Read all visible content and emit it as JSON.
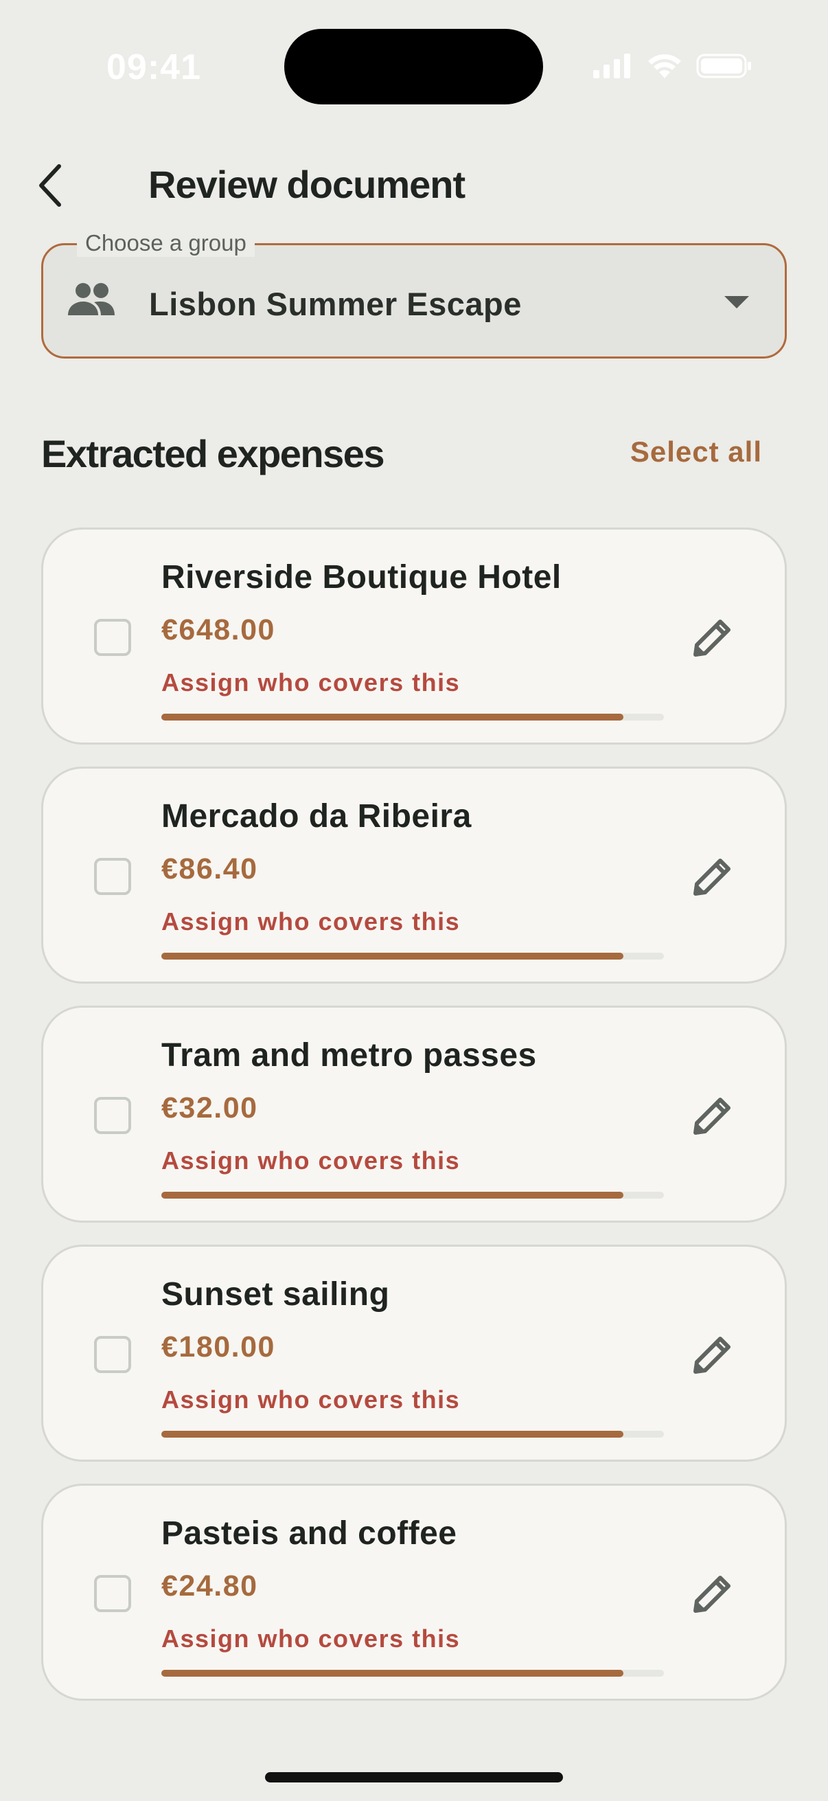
{
  "status_bar": {
    "time": "09:41"
  },
  "header": {
    "title": "Review document"
  },
  "group_select": {
    "label": "Choose a group",
    "value": "Lisbon Summer Escape"
  },
  "expenses_section": {
    "title": "Extracted expenses",
    "select_all": "Select all"
  },
  "expenses": [
    {
      "name": "Riverside Boutique Hotel",
      "amount": "€648.00",
      "assign": "Assign who covers this",
      "progress": 0.92,
      "checked": false
    },
    {
      "name": "Mercado da Ribeira",
      "amount": "€86.40",
      "assign": "Assign who covers this",
      "progress": 0.92,
      "checked": false
    },
    {
      "name": "Tram and metro passes",
      "amount": "€32.00",
      "assign": "Assign who covers this",
      "progress": 0.92,
      "checked": false
    },
    {
      "name": "Sunset sailing",
      "amount": "€180.00",
      "assign": "Assign who covers this",
      "progress": 0.92,
      "checked": false
    },
    {
      "name": "Pasteis and coffee",
      "amount": "€24.80",
      "assign": "Assign who covers this",
      "progress": 0.92,
      "checked": false
    }
  ],
  "icons": {
    "back": "chevron-left-icon",
    "group": "people-icon",
    "dropdown": "caret-down-icon",
    "edit": "pencil-icon"
  },
  "colors": {
    "background": "#ECECE8",
    "accent": "#A66A3E",
    "warning_text": "#B54A3F",
    "card": "#F7F6F2"
  }
}
